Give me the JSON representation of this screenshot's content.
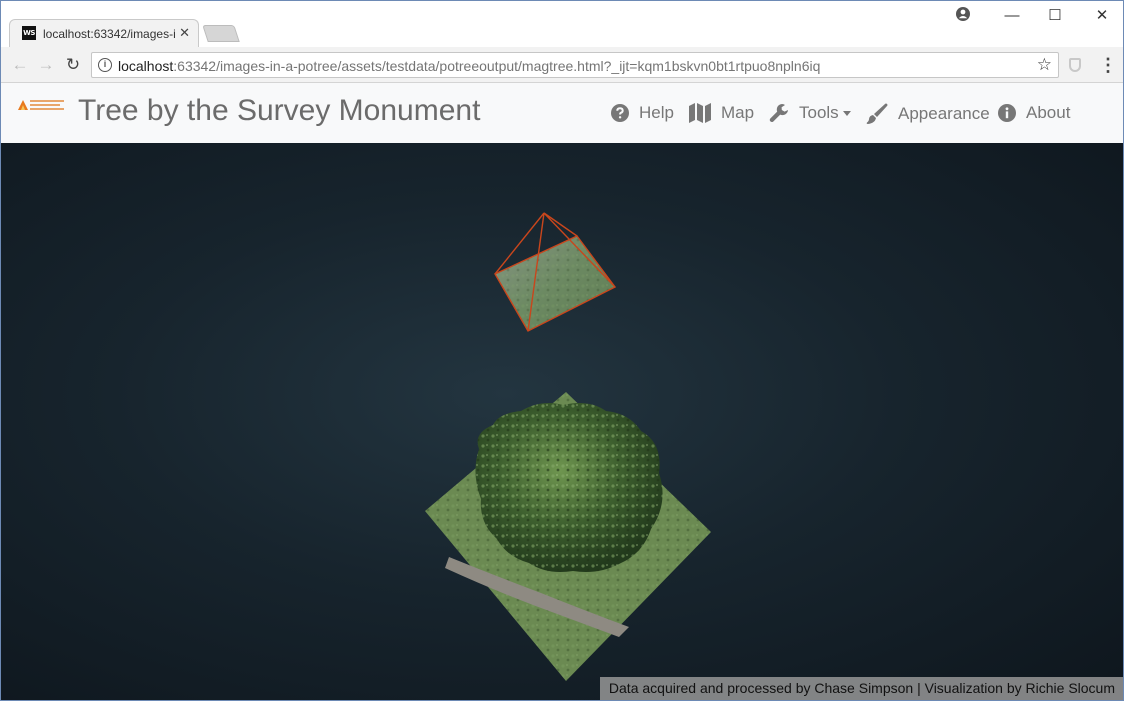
{
  "browser": {
    "tab_title": "localhost:63342/images-i",
    "tab_favicon_text": "WS",
    "url_host": "localhost",
    "url_rest": ":63342/images-in-a-potree/assets/testdata/potreeoutput/magtree.html?_ijt=kqm1bskvn0bt1rtpuo8npln6iq",
    "window_controls": {
      "minimize": "—",
      "maximize": "☐",
      "close": "✕"
    }
  },
  "page": {
    "title": "Tree by the Survey Monument",
    "nav": {
      "help": "Help",
      "map": "Map",
      "tools": "Tools",
      "appearance": "Appearance",
      "about": "About"
    },
    "credits": "Data acquired and processed by Chase Simpson | Visualization by Richie Slocum"
  },
  "icons": {
    "help": "question-circle-icon",
    "map": "map-icon",
    "tools": "wrench-icon",
    "appearance": "paintbrush-icon",
    "about": "info-circle-icon"
  },
  "colors": {
    "frustum": "#c9461c",
    "viewer_bg": "#17242d",
    "nav_text": "#777777"
  }
}
